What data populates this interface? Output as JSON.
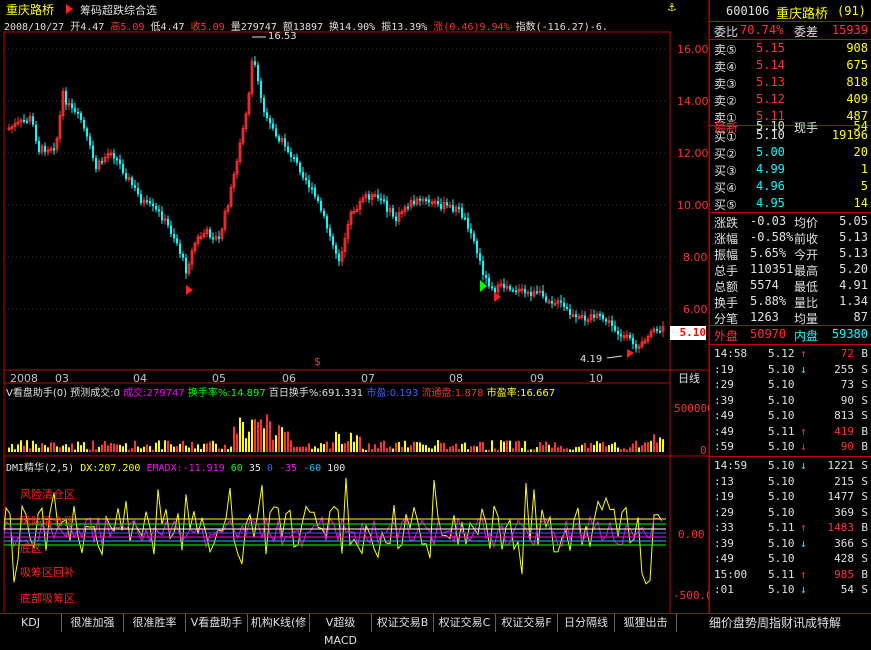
{
  "header": {
    "stock_name": "重庆路桥",
    "subtitle": "筹码超跌综合选"
  },
  "quote_line": {
    "date": "2008/10/27",
    "open": "开4.47",
    "high": "高5.09",
    "low": "低4.47",
    "close": "收5.09",
    "volume": "量279747",
    "amount": "额13897",
    "turnover": "换14.90%",
    "amplitude": "振13.39%",
    "change": "涨(0.46)9.94%",
    "index": "指数(-116.27)-6."
  },
  "price_axis": {
    "labels": [
      "16.00",
      "14.00",
      "12.00",
      "10.00",
      "8.00",
      "6.00"
    ],
    "current": "5.10",
    "peak": "16.53",
    "trough": "4.19"
  },
  "time_axis": {
    "labels": [
      "2008",
      "03",
      "04",
      "05",
      "06",
      "07",
      "08",
      "09",
      "10"
    ],
    "period": "日线",
    "marker": "$"
  },
  "volume_panel": {
    "title": "V看盘助手(0)",
    "predict": "预测成交:0",
    "deal": "成交:279747",
    "turnover": "换手率%:14.897",
    "hundred_day": "百日换手%:691.331",
    "pe": "市盈:0.193",
    "float": "流通盘:1.878",
    "market_pe": "市盈率:16.667",
    "axis_label": "500000",
    "axis_zero": "0"
  },
  "dmi_panel": {
    "title": "DMI精华(2,5)",
    "dx": "DX:207.200",
    "emadx": "EMADX:-11.919",
    "lines": [
      "60",
      "35",
      "0",
      "-35",
      "-60",
      "100"
    ],
    "zones": [
      "风险清仓区",
      "风险清仓区",
      "底区",
      "吸筹区回补",
      "底部吸筹区"
    ],
    "axis": [
      "0.00",
      "-500.0"
    ]
  },
  "right_panel": {
    "code": "600106",
    "name": "重庆路桥",
    "num": "(91)",
    "weibi_label": "委比",
    "weibi": "70.74%",
    "weicha_label": "委差",
    "weicha": "15939",
    "sells": [
      {
        "label": "卖⑤",
        "price": "5.15",
        "vol": "908"
      },
      {
        "label": "卖④",
        "price": "5.14",
        "vol": "675"
      },
      {
        "label": "卖③",
        "price": "5.13",
        "vol": "818"
      },
      {
        "label": "卖②",
        "price": "5.12",
        "vol": "409"
      },
      {
        "label": "卖①",
        "price": "5.11",
        "vol": "487"
      }
    ],
    "latest_label": "最新",
    "latest": "5.10",
    "now_hand_label": "现手",
    "now_hand": "54",
    "buys": [
      {
        "label": "买①",
        "price": "5.10",
        "vol": "19196"
      },
      {
        "label": "买②",
        "price": "5.00",
        "vol": "20"
      },
      {
        "label": "买③",
        "price": "4.99",
        "vol": "1"
      },
      {
        "label": "买④",
        "price": "4.96",
        "vol": "5"
      },
      {
        "label": "买⑤",
        "price": "4.95",
        "vol": "14"
      }
    ],
    "stats": [
      {
        "l1": "涨跌",
        "v1": "-0.03",
        "l2": "均价",
        "v2": "5.05"
      },
      {
        "l1": "涨幅",
        "v1": "-0.58%",
        "l2": "前收",
        "v2": "5.13"
      },
      {
        "l1": "振幅",
        "v1": "5.65%",
        "l2": "今开",
        "v2": "5.13"
      },
      {
        "l1": "总手",
        "v1": "110351",
        "l2": "最高",
        "v2": "5.20"
      },
      {
        "l1": "总额",
        "v1": "5574",
        "l2": "最低",
        "v2": "4.91"
      },
      {
        "l1": "换手",
        "v1": "5.88%",
        "l2": "量比",
        "v2": "1.34"
      },
      {
        "l1": "分笔",
        "v1": "1263",
        "l2": "均量",
        "v2": "87"
      }
    ],
    "outer_label": "外盘",
    "outer": "50970",
    "inner_label": "内盘",
    "inner": "59380",
    "ticks1": [
      {
        "t": "14:58",
        "p": "5.12",
        "a": "↑",
        "v": "72",
        "s": "B"
      },
      {
        "t": ":19",
        "p": "5.10",
        "a": "↓",
        "v": "255",
        "s": "S"
      },
      {
        "t": ":29",
        "p": "5.10",
        "a": "",
        "v": "73",
        "s": "S"
      },
      {
        "t": ":39",
        "p": "5.10",
        "a": "",
        "v": "90",
        "s": "S"
      },
      {
        "t": ":49",
        "p": "5.10",
        "a": "",
        "v": "813",
        "s": "S"
      },
      {
        "t": ":49",
        "p": "5.11",
        "a": "↑",
        "v": "419",
        "s": "B"
      },
      {
        "t": ":59",
        "p": "5.10",
        "a": "↓",
        "v": "90",
        "s": "B"
      }
    ],
    "ticks2": [
      {
        "t": "14:59",
        "p": "5.10",
        "a": "↓",
        "v": "1221",
        "s": "S"
      },
      {
        "t": ":13",
        "p": "5.10",
        "a": "",
        "v": "215",
        "s": "S"
      },
      {
        "t": ":19",
        "p": "5.10",
        "a": "",
        "v": "1477",
        "s": "S"
      },
      {
        "t": ":29",
        "p": "5.10",
        "a": "",
        "v": "369",
        "s": "S"
      },
      {
        "t": ":33",
        "p": "5.11",
        "a": "↑",
        "v": "1483",
        "s": "B"
      },
      {
        "t": ":39",
        "p": "5.10",
        "a": "↓",
        "v": "366",
        "s": "S"
      },
      {
        "t": ":49",
        "p": "5.10",
        "a": "",
        "v": "428",
        "s": "S"
      },
      {
        "t": "15:00",
        "p": "5.11",
        "a": "↑",
        "v": "985",
        "s": "B"
      },
      {
        "t": ":01",
        "p": "5.10",
        "a": "↓",
        "v": "54",
        "s": "S"
      }
    ]
  },
  "tabs": [
    "KDJ",
    "很准加强",
    "很准胜率",
    "V看盘助手",
    "机构K线(修",
    "V超级MACD",
    "权证交易B",
    "权证交易C",
    "权证交易F",
    "日分隔线",
    "狐狸出击"
  ],
  "right_tabs": "细价盘势周指财讯成特解",
  "colors": {
    "up": "#ff3030",
    "down": "#00ffff",
    "frame": "#c00000",
    "text": "#c0c0c0"
  }
}
